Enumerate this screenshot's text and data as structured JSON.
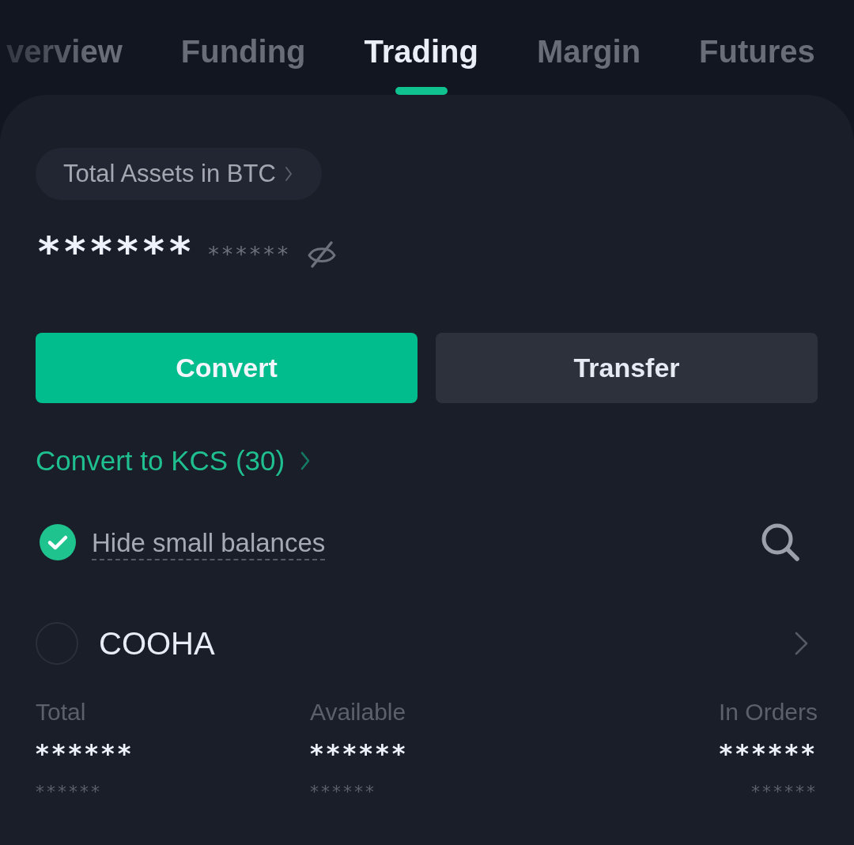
{
  "tabs": [
    {
      "label": "verview",
      "selected": false
    },
    {
      "label": "Funding",
      "selected": false
    },
    {
      "label": "Trading",
      "selected": true
    },
    {
      "label": "Margin",
      "selected": false
    },
    {
      "label": "Futures",
      "selected": false
    }
  ],
  "summary": {
    "label": "Total Assets in BTC",
    "value": "******",
    "fiat_value": "******",
    "balance_visible": false
  },
  "buttons": [
    {
      "label": "Convert",
      "kind": "primary"
    },
    {
      "label": "Transfer",
      "kind": "secondary"
    }
  ],
  "convert_link": "Convert to KCS (30)",
  "filter": {
    "label": "Hide small balances",
    "checked": true
  },
  "assets": [
    {
      "name": "COOHA",
      "columns": [
        {
          "label": "Total",
          "value": "******",
          "sub_value": "******"
        },
        {
          "label": "Available",
          "value": "******",
          "sub_value": "******"
        },
        {
          "label": "In Orders",
          "value": "******",
          "sub_value": "******"
        }
      ]
    }
  ]
}
